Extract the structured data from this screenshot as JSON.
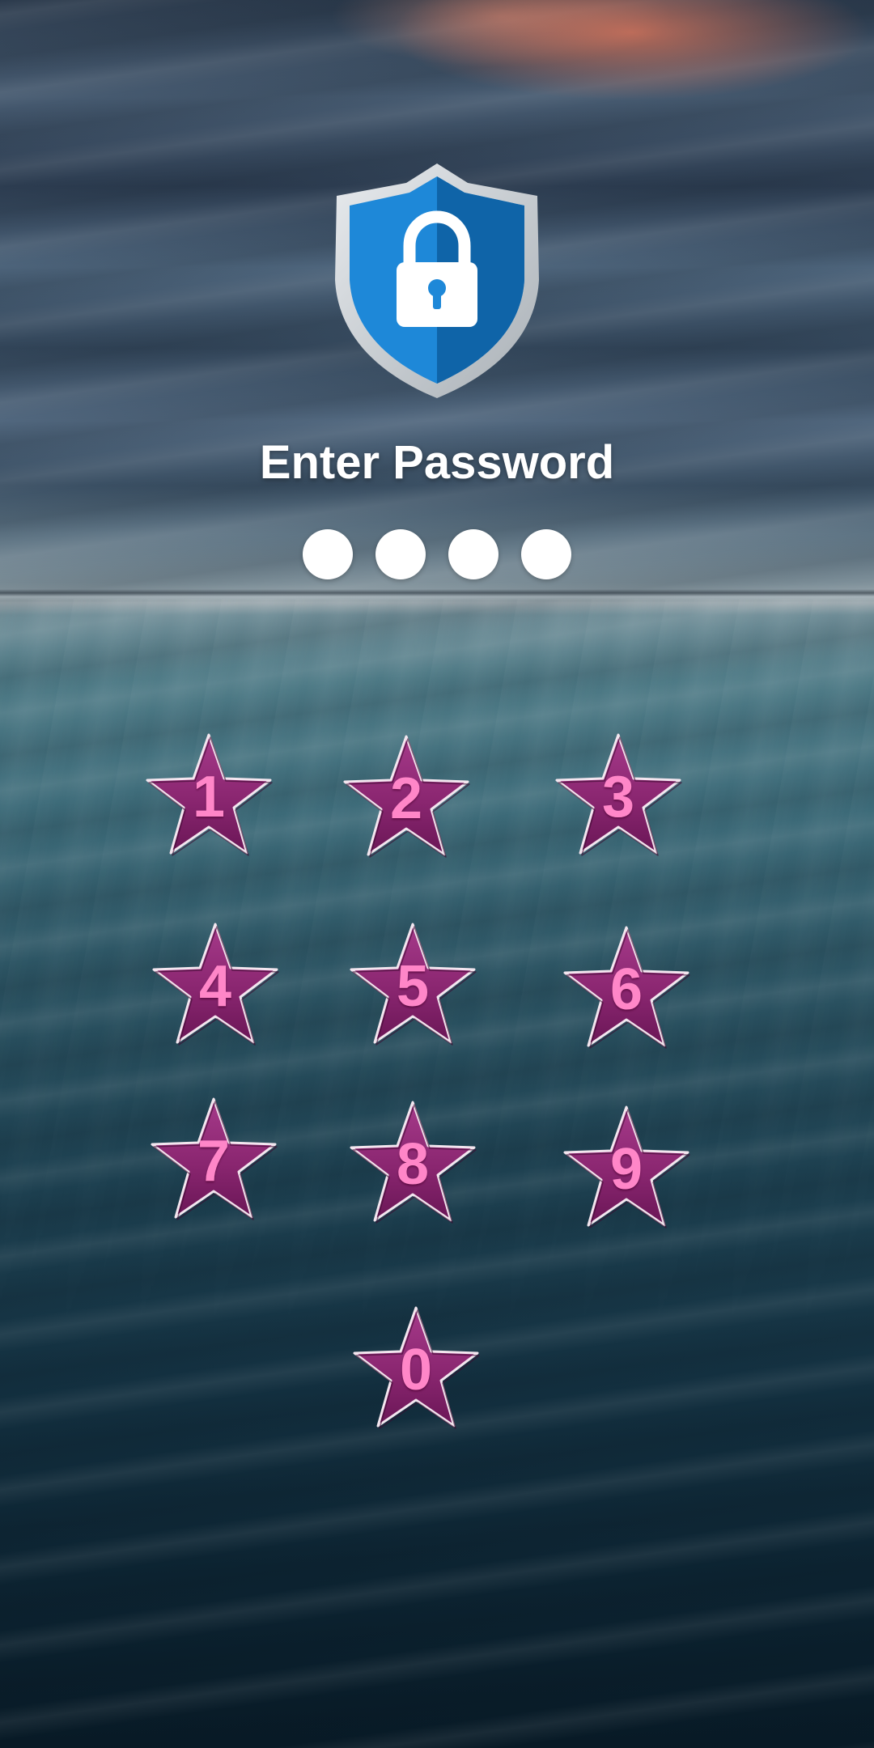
{
  "lock_screen": {
    "title": "Enter Password",
    "icon": "shield-lock-icon",
    "pin_indicator_count": 4
  },
  "keypad": {
    "keys": [
      "1",
      "2",
      "3",
      "4",
      "5",
      "6",
      "7",
      "8",
      "9",
      "0"
    ],
    "key_shape": "star-icon"
  },
  "colors": {
    "shield_blue": "#1e88d8",
    "shield_dark_blue": "#0f64a8",
    "shield_rim": "#c9ced3",
    "star_fill": "#8e2a73",
    "star_digit": "#ff86c8",
    "title_text": "#ffffff"
  }
}
